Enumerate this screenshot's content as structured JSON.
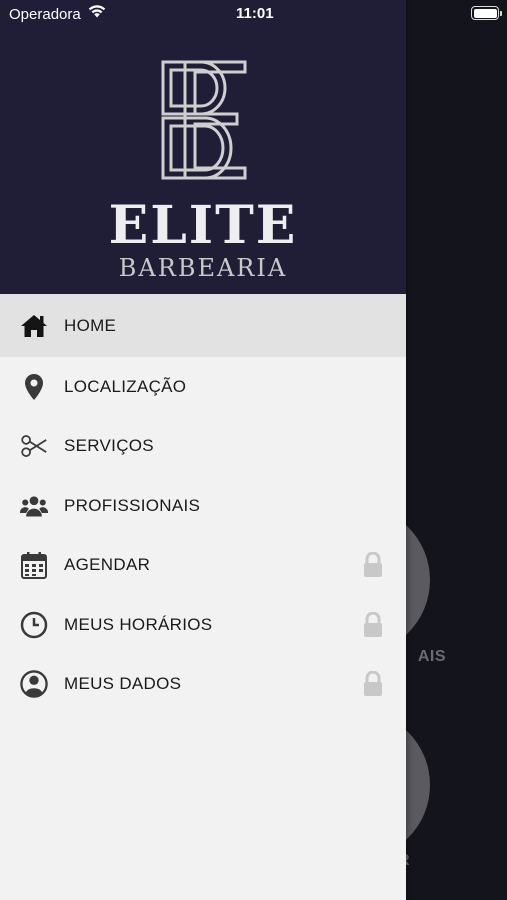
{
  "status_bar": {
    "carrier": "Operadora",
    "time": "11:01"
  },
  "brand": {
    "title": "ELITE",
    "subtitle": "BARBEARIA",
    "header_color": "#201d36"
  },
  "menu": {
    "items": [
      {
        "label": "HOME",
        "icon": "home-icon",
        "active": true,
        "locked": false
      },
      {
        "label": "LOCALIZAÇÃO",
        "icon": "map-pin-icon",
        "active": false,
        "locked": false
      },
      {
        "label": "SERVIÇOS",
        "icon": "scissors-icon",
        "active": false,
        "locked": false
      },
      {
        "label": "PROFISSIONAIS",
        "icon": "users-icon",
        "active": false,
        "locked": false
      },
      {
        "label": "AGENDAR",
        "icon": "calendar-icon",
        "active": false,
        "locked": true
      },
      {
        "label": "MEUS HORÁRIOS",
        "icon": "clock-icon",
        "active": false,
        "locked": true
      },
      {
        "label": "MEUS DADOS",
        "icon": "user-circle-icon",
        "active": false,
        "locked": true
      }
    ]
  },
  "background": {
    "label_1": "AIS",
    "label_2": "R"
  }
}
